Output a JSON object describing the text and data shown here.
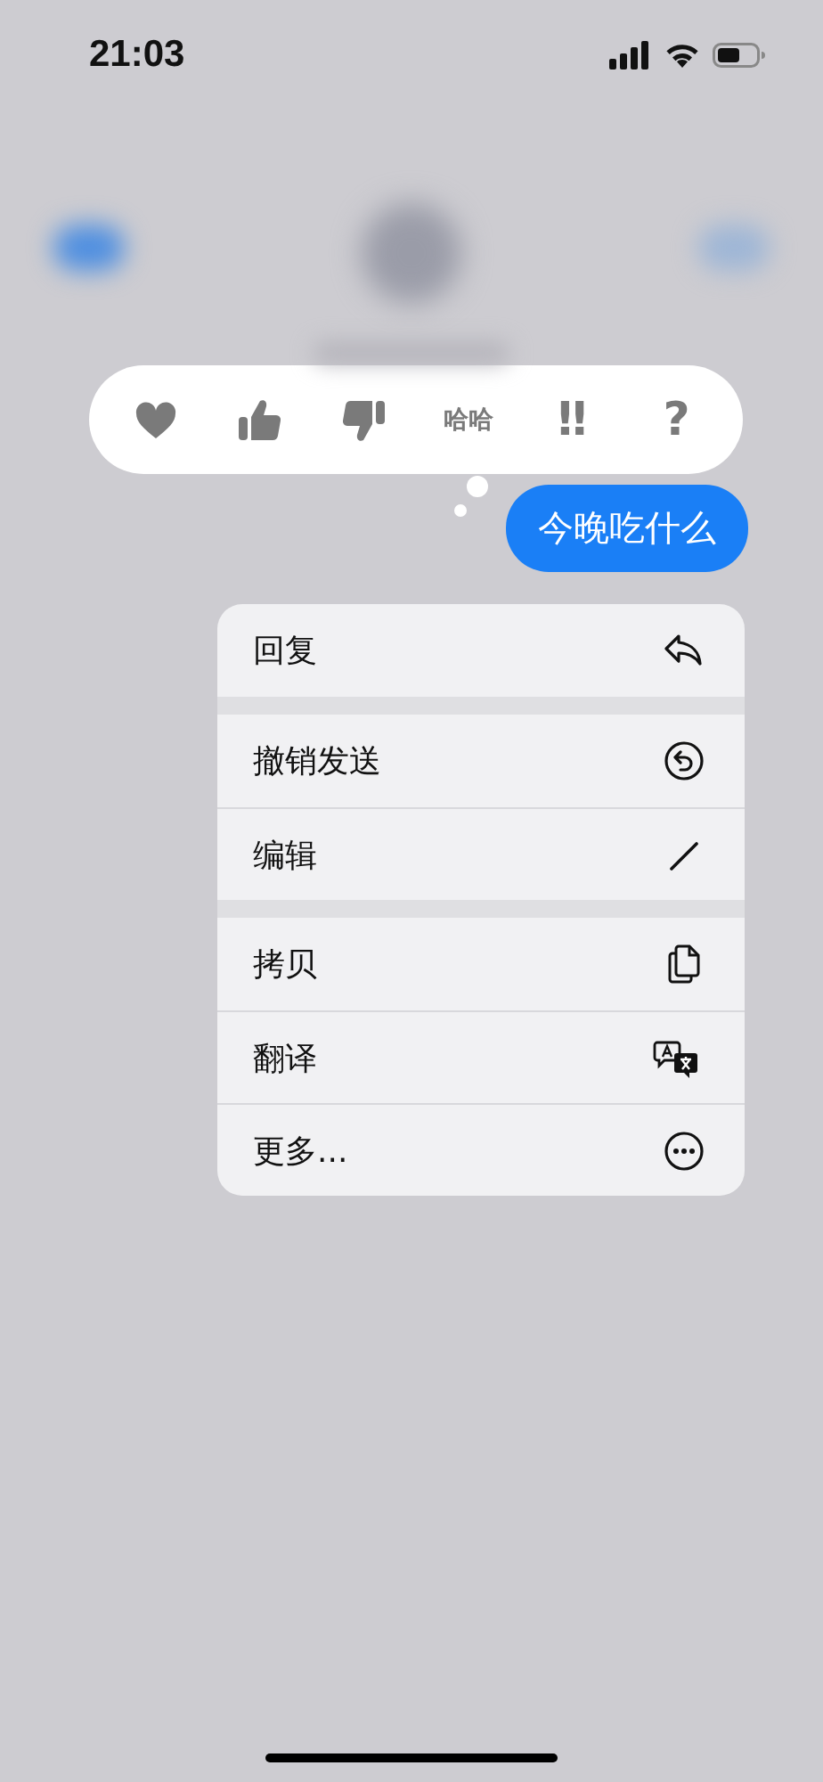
{
  "status_bar": {
    "time": "21:03"
  },
  "reactions": [
    {
      "kind": "heart"
    },
    {
      "kind": "thumbs-up"
    },
    {
      "kind": "thumbs-down"
    },
    {
      "kind": "text",
      "label": "哈哈"
    },
    {
      "kind": "text",
      "label": "‼"
    },
    {
      "kind": "text",
      "label": "?"
    }
  ],
  "message": {
    "text": "今晚吃什么"
  },
  "menu": {
    "sections": [
      {
        "items": [
          {
            "label": "回复",
            "kind": "reply"
          }
        ]
      },
      {
        "items": [
          {
            "label": "撤销发送",
            "kind": "undo"
          },
          {
            "label": "编辑",
            "kind": "pencil"
          }
        ]
      },
      {
        "items": [
          {
            "label": "拷贝",
            "kind": "copy"
          },
          {
            "label": "翻译",
            "kind": "translate"
          },
          {
            "label": "更多...",
            "kind": "more"
          }
        ]
      }
    ]
  }
}
